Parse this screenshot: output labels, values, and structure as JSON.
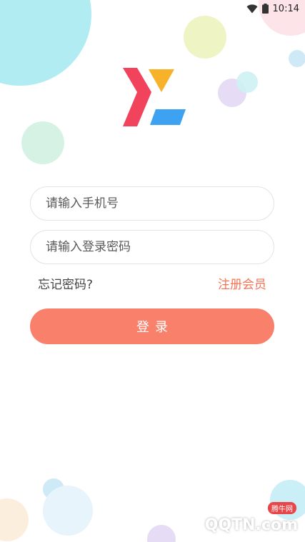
{
  "status_bar": {
    "time": "10:14",
    "icons": [
      "wifi-icon",
      "battery-icon"
    ]
  },
  "form": {
    "phone_placeholder": "请输入手机号",
    "password_placeholder": "请输入登录密码",
    "forgot_label": "忘记密码?",
    "register_label": "注册会员",
    "login_label": "登录"
  },
  "watermark": {
    "brand": "QQTN.com",
    "badge": "腾牛网"
  },
  "colors": {
    "accent": "#f9806b",
    "link": "#f47456",
    "logo_red": "#f2435d",
    "logo_orange": "#f8b22a",
    "logo_blue": "#3ea2f3"
  }
}
